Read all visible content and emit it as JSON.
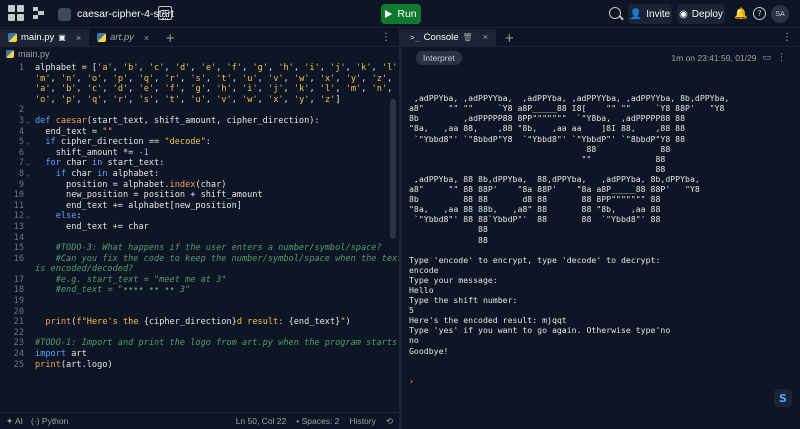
{
  "topbar": {
    "project_name": "caesar-cipher-4-start",
    "run_label": "Run",
    "invite_label": "Invite",
    "deploy_label": "Deploy",
    "user_initials": "SA"
  },
  "editor": {
    "tabs": [
      {
        "label": "main.py"
      },
      {
        "label": "art.py"
      }
    ],
    "breadcrumb": "main.py",
    "lines": [
      {
        "n": "1",
        "html": "alphabet = [<span class=\"str\">'a'</span>, <span class=\"str\">'b'</span>, <span class=\"str\">'c'</span>, <span class=\"str\">'d'</span>, <span class=\"str\">'e'</span>, <span class=\"str\">'f'</span>, <span class=\"str\">'g'</span>, <span class=\"str\">'h'</span>, <span class=\"str\">'i'</span>, <span class=\"str\">'j'</span>, <span class=\"str\">'k'</span>, <span class=\"str\">'l'</span>,"
      },
      {
        "n": "",
        "html": "<span class=\"str\">'m'</span>, <span class=\"str\">'n'</span>, <span class=\"str\">'o'</span>, <span class=\"str\">'p'</span>, <span class=\"str\">'q'</span>, <span class=\"str\">'r'</span>, <span class=\"str\">'s'</span>, <span class=\"str\">'t'</span>, <span class=\"str\">'u'</span>, <span class=\"str\">'v'</span>, <span class=\"str\">'w'</span>, <span class=\"str\">'x'</span>, <span class=\"str\">'y'</span>, <span class=\"str\">'z'</span>,"
      },
      {
        "n": "",
        "html": "<span class=\"str\">'a'</span>, <span class=\"str\">'b'</span>, <span class=\"str\">'c'</span>, <span class=\"str\">'d'</span>, <span class=\"str\">'e'</span>, <span class=\"str\">'f'</span>, <span class=\"str\">'g'</span>, <span class=\"str\">'h'</span>, <span class=\"str\">'i'</span>, <span class=\"str\">'j'</span>, <span class=\"str\">'k'</span>, <span class=\"str\">'l'</span>, <span class=\"str\">'m'</span>, <span class=\"str\">'n'</span>,"
      },
      {
        "n": "",
        "html": "<span class=\"str\">'o'</span>, <span class=\"str\">'p'</span>, <span class=\"str\">'q'</span>, <span class=\"str\">'r'</span>, <span class=\"str\">'s'</span>, <span class=\"str\">'t'</span>, <span class=\"str\">'u'</span>, <span class=\"str\">'v'</span>, <span class=\"str\">'w'</span>, <span class=\"str\">'x'</span>, <span class=\"str\">'y'</span>, <span class=\"str\">'z'</span>]"
      },
      {
        "n": "2",
        "html": ""
      },
      {
        "n": "3",
        "html": "<span class=\"kw\">def</span> <span class=\"fn\">caesar</span>(start_text, shift_amount, cipher_direction):"
      },
      {
        "n": "4",
        "html": "  end_text = <span class=\"str\">\"\"</span>"
      },
      {
        "n": "5",
        "html": "  <span class=\"kw\">if</span> cipher_direction == <span class=\"str\">\"decode\"</span>:"
      },
      {
        "n": "6",
        "html": "    shift_amount *= <span class=\"num\">-1</span>"
      },
      {
        "n": "7",
        "html": "  <span class=\"kw\">for</span> char <span class=\"kw\">in</span> start_text:"
      },
      {
        "n": "8",
        "html": "    <span class=\"kw\">if</span> char <span class=\"kw\">in</span> alphabet:"
      },
      {
        "n": "9",
        "html": "      position = alphabet.<span class=\"fn\">index</span>(char)"
      },
      {
        "n": "10",
        "html": "      new_position = position + shift_amount"
      },
      {
        "n": "11",
        "html": "      end_text += alphabet[new_position]"
      },
      {
        "n": "12",
        "html": "    <span class=\"kw\">else</span>:"
      },
      {
        "n": "13",
        "html": "      end_text += char"
      },
      {
        "n": "14",
        "html": ""
      },
      {
        "n": "15",
        "html": "    <span class=\"cmt\">#TODO-3: What happens if the user enters a number/symbol/space?</span>"
      },
      {
        "n": "16",
        "html": "    <span class=\"cmt\">#Can you fix the code to keep the number/symbol/space when the text</span>"
      },
      {
        "n": "",
        "html": "<span class=\"cmt\">is encoded/decoded?</span>"
      },
      {
        "n": "17",
        "html": "    <span class=\"cmt\">#e.g. start_text = \"meet me at 3\"</span>"
      },
      {
        "n": "18",
        "html": "    <span class=\"cmt\">#end_text = \"•••• •• •• 3\"</span>"
      },
      {
        "n": "19",
        "html": ""
      },
      {
        "n": "20",
        "html": ""
      },
      {
        "n": "21",
        "html": "  <span class=\"fn\">print</span>(<span class=\"str\">f\"Here's the </span>{cipher_direction}<span class=\"str\">d result: </span>{end_text}<span class=\"str\">\"</span>)"
      },
      {
        "n": "22",
        "html": ""
      },
      {
        "n": "23",
        "html": "<span class=\"cmt\">#TODO-1: Import and print the logo from art.py when the program starts.</span>"
      },
      {
        "n": "24",
        "html": "<span class=\"kw\">import</span> art"
      },
      {
        "n": "25",
        "html": "<span class=\"fn\">print</span>(art.logo)"
      }
    ],
    "fold_lines": [
      "3",
      "5",
      "7",
      "8",
      "12"
    ],
    "status": {
      "ai": "AI",
      "language": "Python",
      "cursor": "Ln 50, Col 22",
      "spaces": "Spaces: 2",
      "history": "History"
    }
  },
  "console": {
    "tab_label": "Console",
    "interpret_label": "Interpret",
    "timestamp": "1m on 23:41:59, 01/29",
    "output": " ,adPPYba, ,adPPYYba,  ,adPPYba, ,adPPYYba, ,adPPYYba, 8b,dPPYba,\na8\"     \"\" \"\"     `Y8 a8P_____88 I8[    \"\" \"\"     `Y8 88P'   \"Y8\n8b         ,adPPPPP88 8PP\"\"\"\"\"\"\"  `\"Y8ba,  ,adPPPPP88 88\n\"8a,   ,aa 88,    ,88 \"8b,   ,aa aa    ]8I 88,    ,88 88\n `\"Ybbd8\"' `\"8bbdP\"Y8  `\"Ybbd8\"' `\"YbbdP\"' `\"8bbdP\"Y8 88\n                                    88             88\n                                   \"\"             88\n                                                  88\n ,adPPYba, 88 8b,dPPYba,  88,dPPYba,   ,adPPYba, 8b,dPPYba,\na8\"     \"\" 88 88P'    \"8a 88P'    \"8a a8P_____88 88P'   \"Y8\n8b         88 88       d8 88       88 8PP\"\"\"\"\"\"\" 88\n\"8a,   ,aa 88 88b,   ,a8\" 88       88 \"8b,   ,aa 88\n `\"Ybbd8\"' 88 88`YbbdP\"'  88       88  `\"Ybbd8\"' 88\n              88\n              88\n\nType 'encode' to encrypt, type 'decode' to decrypt:\nencode\nType your message:\nHello\nType the shift number:\n5\nHere's the encoded result: mjqqt\nType 'yes' if you want to go again. Otherwise type'no\nno\nGoodbye!",
    "prompt": "›"
  }
}
